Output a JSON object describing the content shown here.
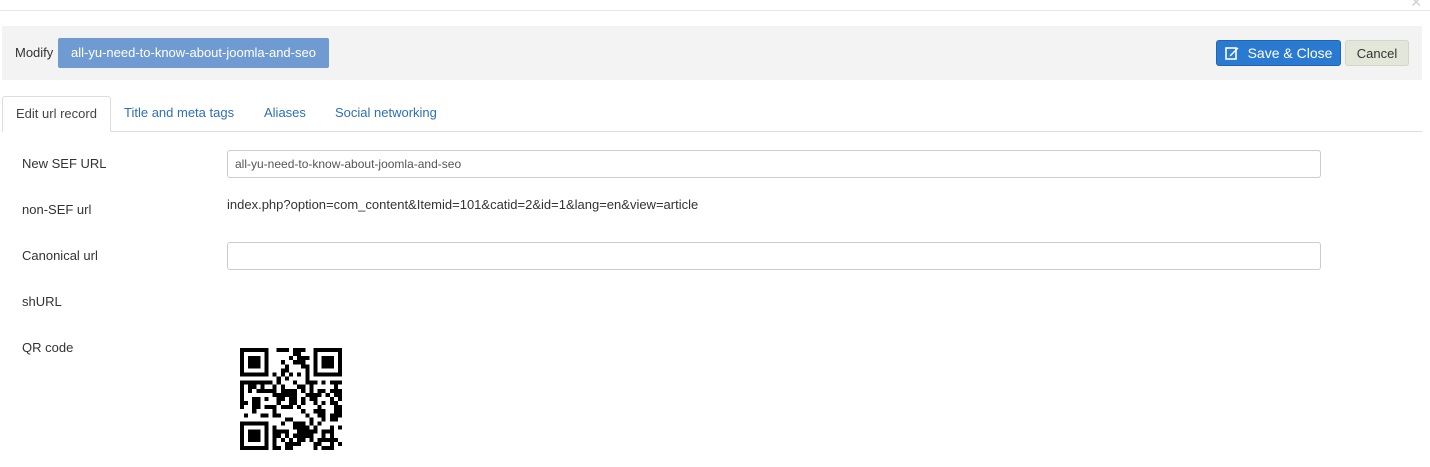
{
  "toolbar": {
    "modify_label": "Modify",
    "alias": "all-yu-need-to-know-about-joomla-and-seo",
    "save_label": "Save & Close",
    "cancel_label": "Cancel"
  },
  "tabs": [
    {
      "label": "Edit url record",
      "active": true
    },
    {
      "label": "Title and meta tags",
      "active": false
    },
    {
      "label": "Aliases",
      "active": false
    },
    {
      "label": "Social networking",
      "active": false
    }
  ],
  "form": {
    "new_sef_url": {
      "label": "New SEF URL",
      "value": "all-yu-need-to-know-about-joomla-and-seo"
    },
    "non_sef_url": {
      "label": "non-SEF url",
      "value": "index.php?option=com_content&Itemid=101&catid=2&id=1&lang=en&view=article"
    },
    "canonical_url": {
      "label": "Canonical url",
      "value": ""
    },
    "shurl": {
      "label": "shURL"
    },
    "qr_code": {
      "label": "QR code"
    }
  },
  "colors": {
    "accent": "#2a7ad2",
    "badge": "#6f9bd2",
    "tab_link": "#2f6fb5"
  },
  "icons": {
    "save": "edit-icon",
    "close": "close-icon",
    "qr": "qr-code-image"
  }
}
